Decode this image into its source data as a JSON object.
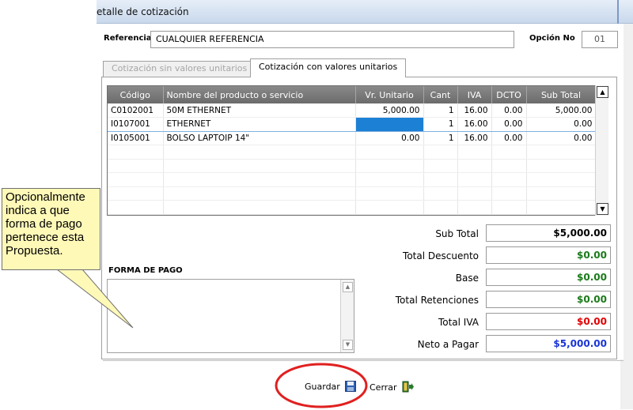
{
  "window": {
    "title": "etalle de cotización"
  },
  "header": {
    "referencia_label": "Referencia",
    "referencia_value": "CUALQUIER REFERENCIA",
    "opcion_label": "Opción No",
    "opcion_value": "01"
  },
  "tabs": [
    {
      "label": "Cotización sin valores unitarios",
      "active": false
    },
    {
      "label": "Cotización con valores unitarios",
      "active": true
    }
  ],
  "grid": {
    "columns": [
      "Código",
      "Nombre del producto o servicio",
      "Vr. Unitario",
      "Cant",
      "IVA",
      "DCTO",
      "Sub Total"
    ],
    "rows": [
      [
        "C0102001",
        "50M ETHERNET",
        "5,000.00",
        "1",
        "16.00",
        "0.00",
        "5,000.00"
      ],
      [
        "I0107001",
        "ETHERNET",
        "",
        "1",
        "16.00",
        "0.00",
        "0.00"
      ],
      [
        "I0105001",
        "BOLSO LAPTOIP 14\"",
        "0.00",
        "1",
        "16.00",
        "0.00",
        "0.00"
      ]
    ],
    "selected_row": 1
  },
  "forma_pago": {
    "label": "FORMA DE PAGO",
    "value": ""
  },
  "totals": [
    {
      "label": "Sub Total",
      "value": "$5,000.00",
      "color": "#000000"
    },
    {
      "label": "Total Descuento",
      "value": "$0.00",
      "color": "#1a7a1a"
    },
    {
      "label": "Base",
      "value": "$0.00",
      "color": "#1a7a1a"
    },
    {
      "label": "Total Retenciones",
      "value": "$0.00",
      "color": "#1a7a1a"
    },
    {
      "label": "Total IVA",
      "value": "$0.00",
      "color": "#e00000"
    },
    {
      "label": "Neto a Pagar",
      "value": "$5,000.00",
      "color": "#1a35d6"
    }
  ],
  "actions": {
    "guardar_label": "Guardar",
    "guardar_icon": "floppy-disk-icon",
    "cerrar_label": "Cerrar",
    "cerrar_icon": "exit-door-icon"
  },
  "callout": {
    "text": "Opcionalmente indica a que forma de pago pertenece esta Propuesta."
  }
}
